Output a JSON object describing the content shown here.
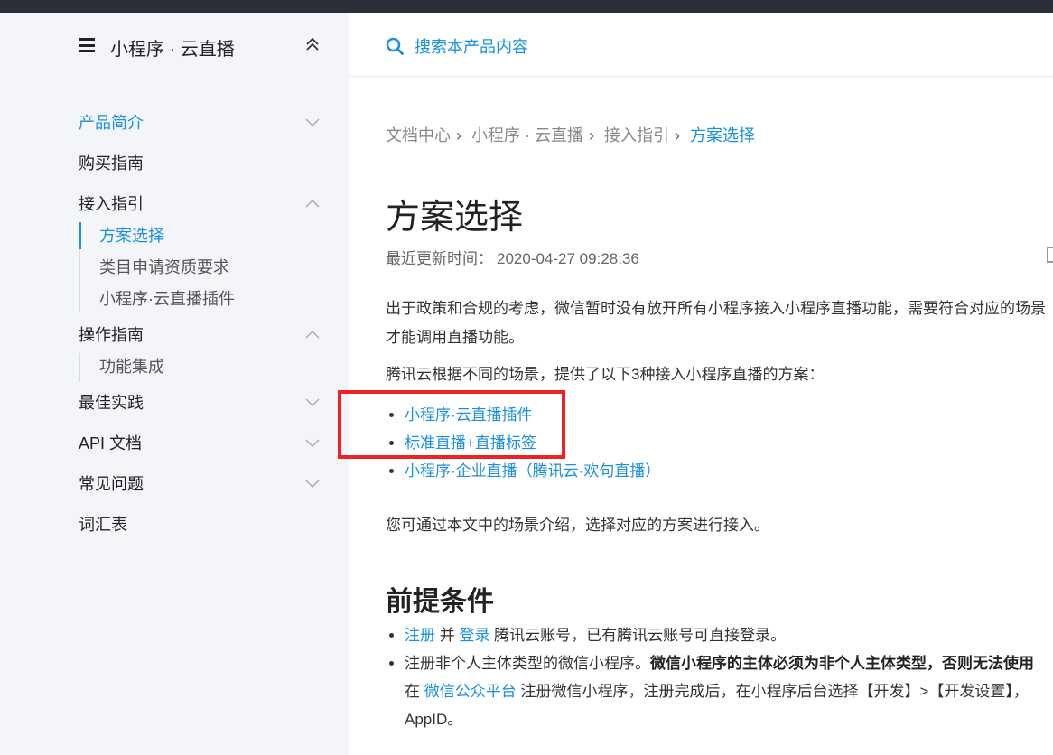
{
  "sidebar": {
    "title": "小程序 · 云直播",
    "items": [
      {
        "label": "产品简介",
        "active": true,
        "expandable": true,
        "expanded": false
      },
      {
        "label": "购买指南",
        "active": false,
        "expandable": false
      },
      {
        "label": "接入指引",
        "active": false,
        "expandable": true,
        "expanded": true,
        "children": [
          {
            "label": "方案选择",
            "active": true
          },
          {
            "label": "类目申请资质要求",
            "active": false
          },
          {
            "label": "小程序·云直播插件",
            "active": false
          }
        ]
      },
      {
        "label": "操作指南",
        "active": false,
        "expandable": true,
        "expanded": true,
        "children": [
          {
            "label": "功能集成",
            "active": false
          }
        ]
      },
      {
        "label": "最佳实践",
        "active": false,
        "expandable": true,
        "expanded": false
      },
      {
        "label": "API 文档",
        "active": false,
        "expandable": true,
        "expanded": false
      },
      {
        "label": "常见问题",
        "active": false,
        "expandable": true,
        "expanded": false
      },
      {
        "label": "词汇表",
        "active": false,
        "expandable": false
      }
    ]
  },
  "search": {
    "placeholder": "搜索本产品内容"
  },
  "breadcrumb": [
    "文档中心",
    "小程序 · 云直播",
    "接入指引",
    "方案选择"
  ],
  "article": {
    "title": "方案选择",
    "updated_label": "最近更新时间：",
    "updated_value": "2020-04-27 09:28:36",
    "intro_line1": "出于政策和合规的考虑，微信暂时没有放开所有小程序接入小程序直播功能，需要符合对应的场景",
    "intro_line2": "才能调用直播功能。",
    "options_intro": "腾讯云根据不同的场景，提供了以下3种接入小程序直播的方案：",
    "options": [
      "小程序·云直播插件",
      "标准直播+直播标签",
      "小程序·企业直播（腾讯云·欢句直播）"
    ],
    "choose_text": "您可通过本文中的场景介绍，选择对应的方案进行接入。",
    "prereq_title": "前提条件",
    "prereq": {
      "b1_link1": "注册",
      "b1_and": " 并 ",
      "b1_link2": "登录",
      "b1_rest": " 腾讯云账号，已有腾讯云账号可直接登录。",
      "b2_text": "注册非个人主体类型的微信小程序。",
      "b2_bold": "微信小程序的主体必须为非个人主体类型，否则无法使用",
      "b2_l2_pre": "在 ",
      "b2_l2_link": "微信公众平台",
      "b2_l2_rest": " 注册微信小程序，注册完成后，在小程序后台选择【开发】>【开发设置】，",
      "b2_l3": "AppID。"
    }
  },
  "colors": {
    "accent": "#1a90e0",
    "highlight": "#ee2222",
    "sidebar_bg": "#f3f5f8",
    "topbar": "#2b2f38"
  }
}
